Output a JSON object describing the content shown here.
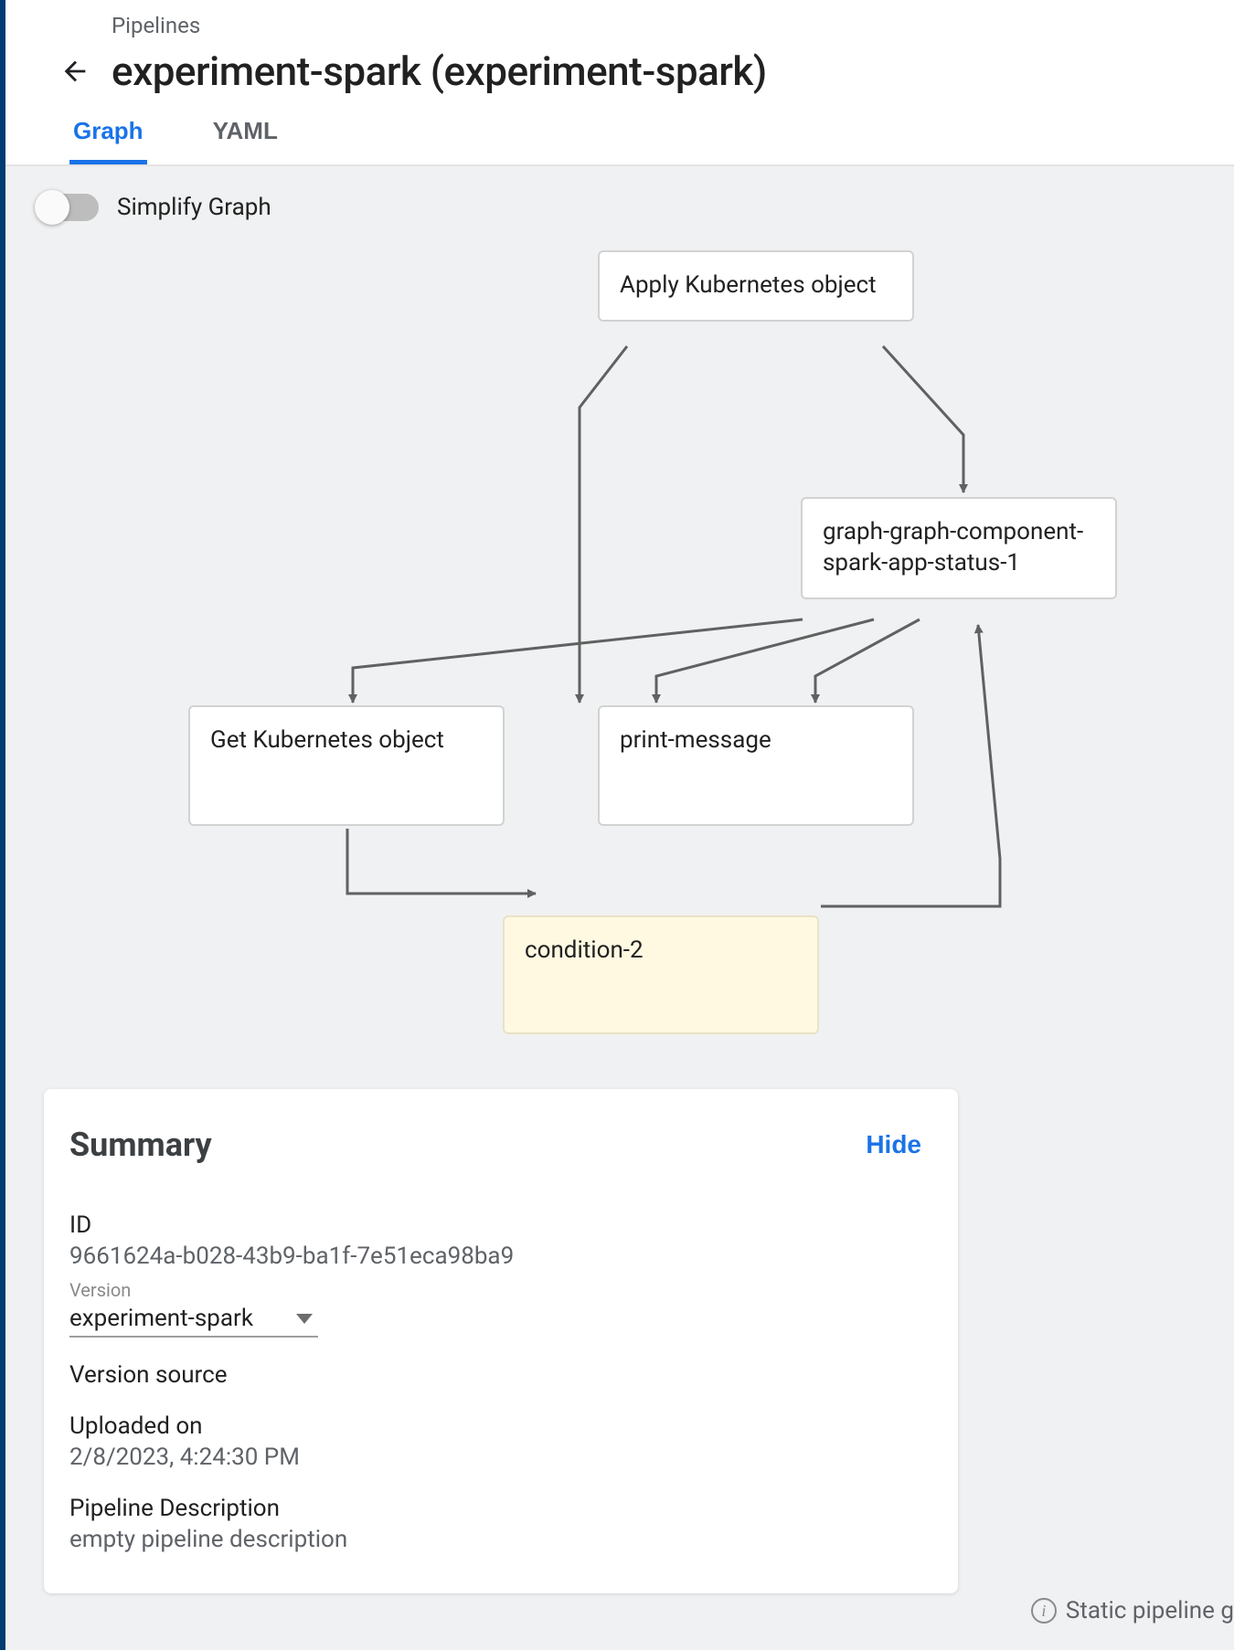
{
  "breadcrumb": "Pipelines",
  "page_title": "experiment-spark (experiment-spark)",
  "tabs": {
    "graph": "Graph",
    "yaml": "YAML",
    "active": "graph"
  },
  "toolbar": {
    "simplify_label": "Simplify Graph",
    "simplify_on": false
  },
  "graph": {
    "nodes": {
      "apply": "Apply Kubernetes object",
      "status": "graph-graph-component-spark-app-status-1",
      "get": "Get Kubernetes object",
      "print": "print-message",
      "cond": "condition-2"
    }
  },
  "summary": {
    "title": "Summary",
    "hide": "Hide",
    "id_label": "ID",
    "id_value": "9661624a-b028-43b9-ba1f-7e51eca98ba9",
    "version_label": "Version",
    "version_value": "experiment-spark",
    "version_source_label": "Version source",
    "uploaded_label": "Uploaded on",
    "uploaded_value": "2/8/2023, 4:24:30 PM",
    "desc_label": "Pipeline Description",
    "desc_value": "empty pipeline description"
  },
  "footer_hint": "Static pipeline g"
}
